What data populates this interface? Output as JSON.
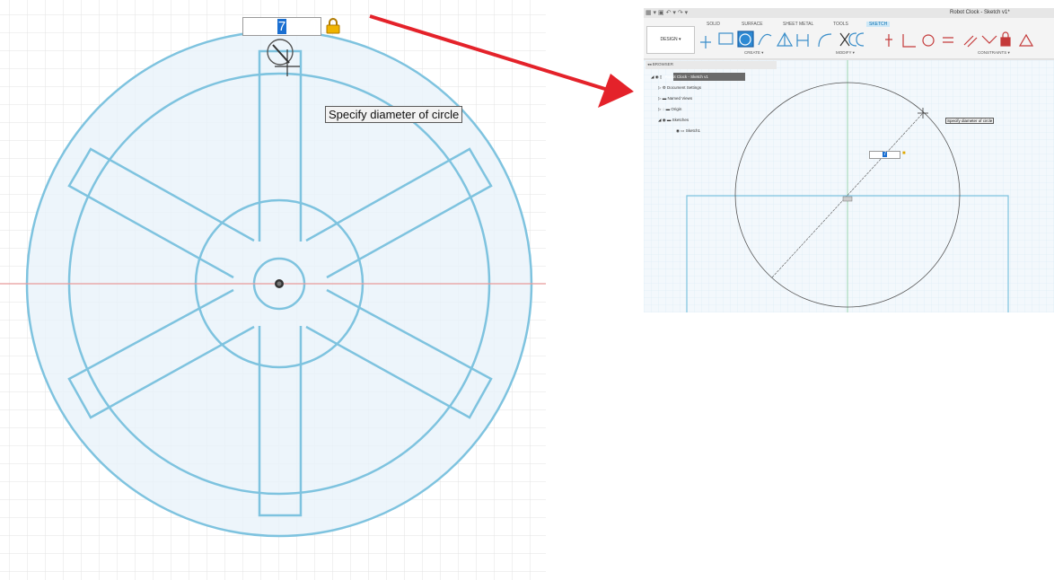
{
  "left_view": {
    "dimension_input": {
      "value": "7"
    },
    "tooltip": "Specify diameter of circle",
    "colors": {
      "sketch": "#7ec3df",
      "fill": "#e8f3fa",
      "axis": "#e27a7a",
      "grid": "#dcdcdc"
    }
  },
  "right_view": {
    "window_title": "Robot Clock - Sketch v1*",
    "tabs": [
      {
        "label": "SOLID"
      },
      {
        "label": "SURFACE"
      },
      {
        "label": "SHEET METAL"
      },
      {
        "label": "TOOLS"
      },
      {
        "label": "SKETCH"
      }
    ],
    "design_button": "DESIGN ▾",
    "groups": {
      "create": "CREATE ▾",
      "modify": "MODIFY ▾",
      "constraints": "CONSTRAINTS ▾"
    },
    "browser": {
      "title": "BROWSER",
      "items": [
        {
          "label": "Robot Clock - Sketch v1"
        },
        {
          "label": "Document Settings"
        },
        {
          "label": "Named Views"
        },
        {
          "label": "Origin"
        },
        {
          "label": "Sketches"
        },
        {
          "label": "Sketch1"
        }
      ]
    },
    "tooltip": "Specify diameter of circle",
    "dimension_input": {
      "value": "7"
    }
  },
  "annotation": {
    "arrow_color": "#e4222a"
  }
}
